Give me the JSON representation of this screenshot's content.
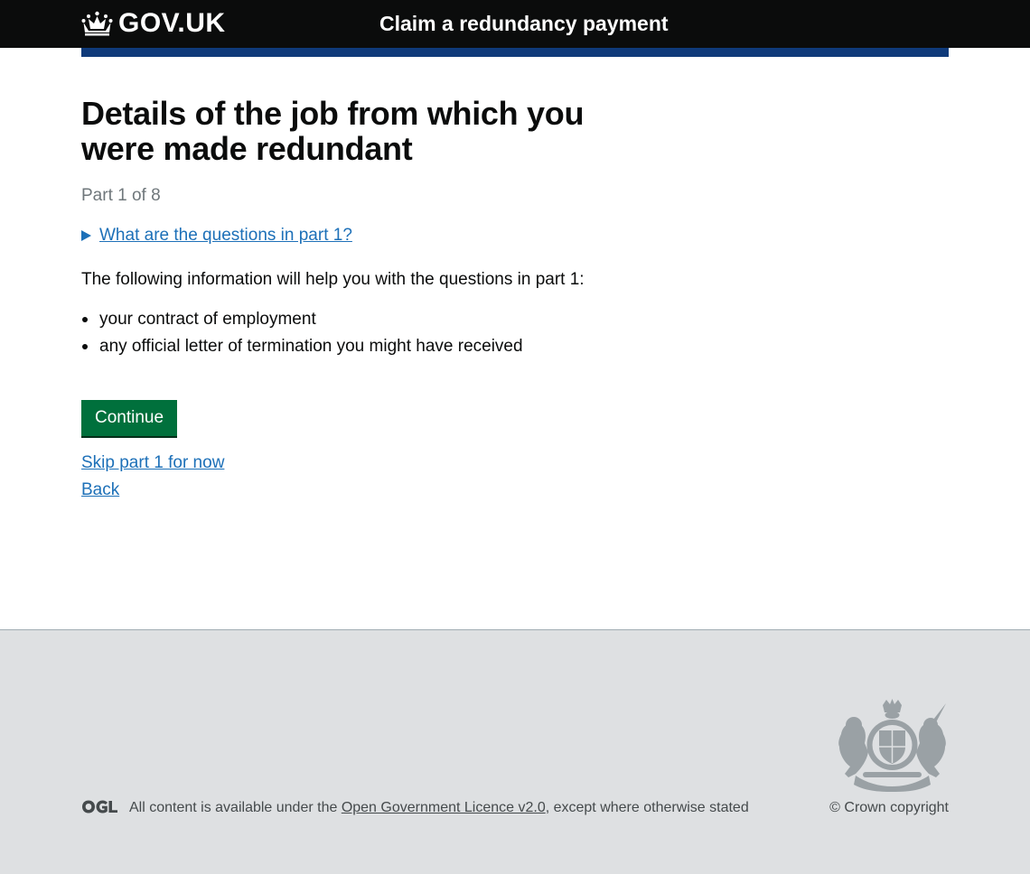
{
  "header": {
    "logo_text": "GOV.UK",
    "service_name": "Claim a redundancy payment"
  },
  "main": {
    "title": "Details of the job from which you were made redundant",
    "caption": "Part 1 of 8",
    "details_summary": "What are the questions in part 1?",
    "intro": "The following information will help you with the questions in part 1:",
    "list": [
      "your contract of employment",
      "any official letter of termination you might have received"
    ],
    "continue_label": "Continue",
    "skip_link": "Skip part 1 for now",
    "back_link": "Back"
  },
  "footer": {
    "ogl_logo": "OGL",
    "licence_prefix": "All content is available under the ",
    "licence_link": "Open Government Licence v2.0",
    "licence_suffix": ", except where otherwise stated",
    "copyright": "© Crown copyright"
  },
  "colors": {
    "header_bg": "#0b0c0c",
    "header_bar": "#0f3a7a",
    "link": "#1d70b8",
    "button": "#00703c",
    "footer_bg": "#dee0e2"
  },
  "icons": {
    "logo": "crown-icon",
    "details": "triangle-right-icon",
    "footer_logo": "ogl-logo",
    "crest": "royal-coat-of-arms"
  }
}
